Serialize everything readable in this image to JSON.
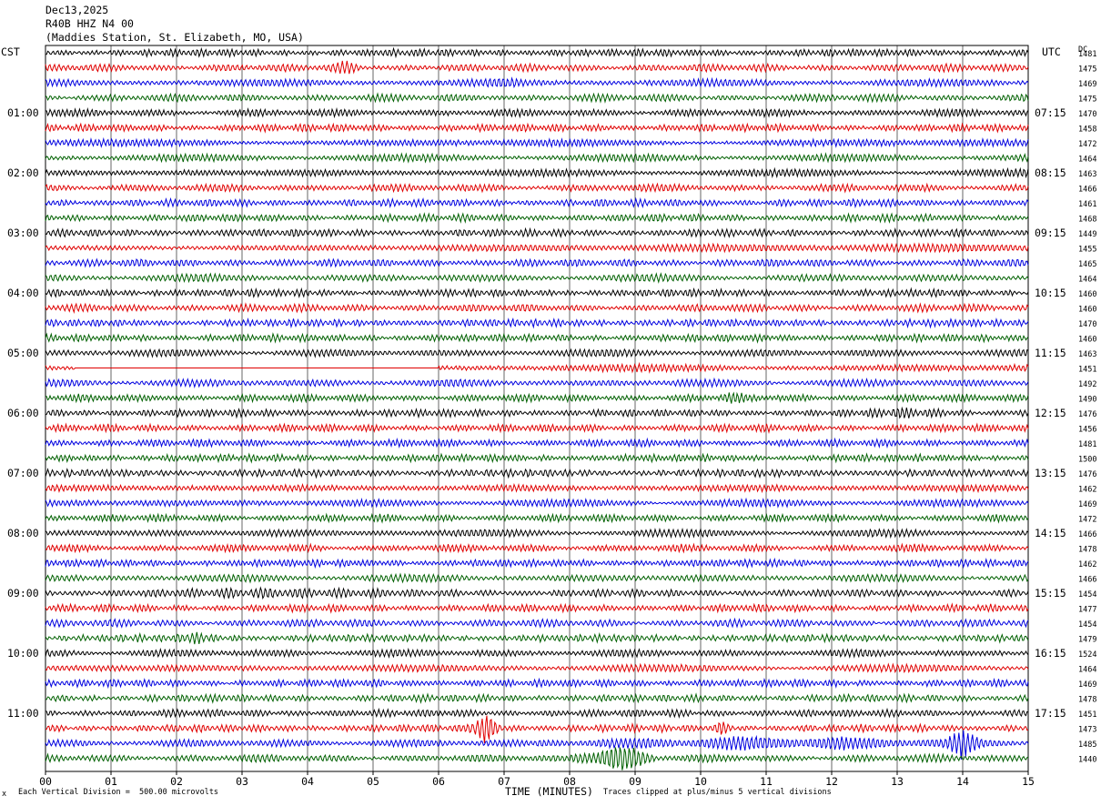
{
  "header": {
    "date": "Dec13,2025",
    "channel": "R40B HHZ N4 00",
    "station": "(Maddies Station, St. Elizabeth, MO, USA)"
  },
  "left_zone_label": "CST",
  "right_zone_label": "UTC",
  "right_column_label": "DC",
  "x_axis_title": "TIME (MINUTES)",
  "footer_scale_note": "Each Vertical Division =  500.00 microvolts",
  "footer_clip_note": "Traces clipped at plus/minus 5 vertical divisions",
  "footer_mark": "x",
  "colors": {
    "trace_cycle": [
      "#000000",
      "#e00000",
      "#0000e0",
      "#006000"
    ],
    "grid": "#000000",
    "background": "#ffffff"
  },
  "chart_data": {
    "type": "line",
    "title": "R40B HHZ N4 00",
    "xlabel": "TIME (MINUTES)",
    "xlim": [
      0,
      15
    ],
    "x_ticks": [
      "00",
      "01",
      "02",
      "03",
      "04",
      "05",
      "06",
      "07",
      "08",
      "09",
      "10",
      "11",
      "12",
      "13",
      "14",
      "15"
    ],
    "rows_per_hour": 4,
    "trace_minutes": 15,
    "left_time_labels": [
      "01:00",
      "02:00",
      "03:00",
      "04:00",
      "05:00",
      "06:00",
      "07:00",
      "08:00",
      "09:00",
      "10:00",
      "11:00"
    ],
    "right_time_labels": [
      "07:15",
      "08:15",
      "09:15",
      "10:15",
      "11:15",
      "12:15",
      "13:15",
      "14:15",
      "15:15",
      "16:15",
      "17:15"
    ],
    "dc_offsets": [
      "1481",
      "1475",
      "1469",
      "1475",
      "1470",
      "1458",
      "1472",
      "1464",
      "1463",
      "1466",
      "1461",
      "1468",
      "1449",
      "1455",
      "1465",
      "1464",
      "1460",
      "1460",
      "1470",
      "1460",
      "1463",
      "1451",
      "1492",
      "1490",
      "1476",
      "1456",
      "1481",
      "1500",
      "1476",
      "1462",
      "1469",
      "1472",
      "1466",
      "1478",
      "1462",
      "1466",
      "1454",
      "1477",
      "1454",
      "1479",
      "1524",
      "1464",
      "1469",
      "1478",
      "1451",
      "1473",
      "1485",
      "1440"
    ],
    "events": [
      {
        "row": 1,
        "start_min": 4.3,
        "end_min": 4.8,
        "amp": 2.0
      },
      {
        "row": 2,
        "start_min": 6.7,
        "end_min": 7.3,
        "amp": 1.6
      },
      {
        "row": 21,
        "start_min": 0.0,
        "end_min": 0.45,
        "amp": 0.3
      },
      {
        "row": 21,
        "start_min": 0.45,
        "end_min": 6.0,
        "amp": 0.0
      },
      {
        "row": 23,
        "start_min": 10.2,
        "end_min": 10.7,
        "amp": 1.8
      },
      {
        "row": 24,
        "start_min": 12.4,
        "end_min": 13.8,
        "amp": 1.6
      },
      {
        "row": 36,
        "start_min": 1.5,
        "end_min": 5.6,
        "amp": 1.5
      },
      {
        "row": 39,
        "start_min": 2.0,
        "end_min": 2.6,
        "amp": 2.0
      },
      {
        "row": 45,
        "start_min": 6.4,
        "end_min": 7.0,
        "amp": 5.0
      },
      {
        "row": 45,
        "start_min": 10.2,
        "end_min": 10.5,
        "amp": 2.5
      },
      {
        "row": 46,
        "start_min": 7.5,
        "end_min": 14.8,
        "amp": 2.2
      },
      {
        "row": 46,
        "start_min": 13.7,
        "end_min": 14.3,
        "amp": 4.5
      },
      {
        "row": 47,
        "start_min": 8.0,
        "end_min": 9.3,
        "amp": 5.0
      }
    ]
  }
}
